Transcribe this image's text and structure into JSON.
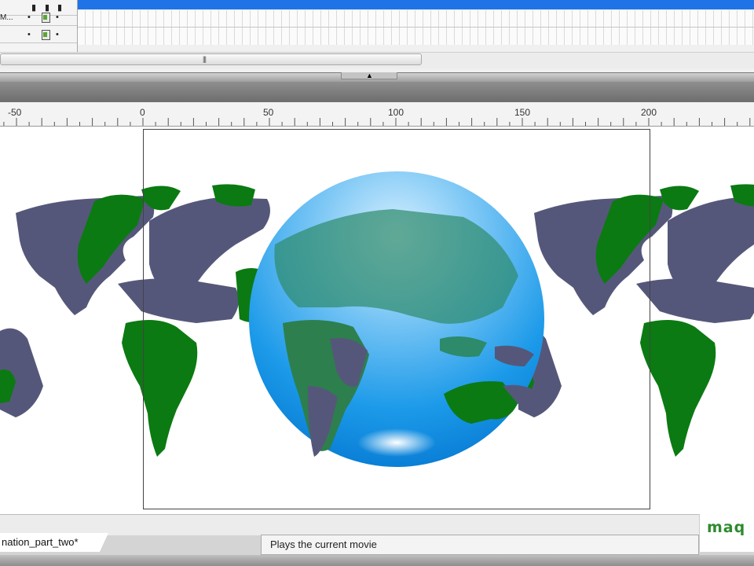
{
  "timeline": {
    "layers": [
      {
        "name": "M..."
      },
      {
        "name": ""
      }
    ]
  },
  "ruler": {
    "labels": [
      "-50",
      "0",
      "50",
      "100",
      "150",
      "200"
    ]
  },
  "stage": {
    "colors": {
      "land_green": "#0b7a12",
      "land_slate": "#55577a",
      "globe_top": "#bfe6ff",
      "globe_bottom": "#0a8de6",
      "frame": "#444444"
    }
  },
  "document": {
    "tab_label": "nation_part_two*"
  },
  "status": {
    "message": "Plays the current movie"
  },
  "logo": {
    "text": "maq"
  }
}
